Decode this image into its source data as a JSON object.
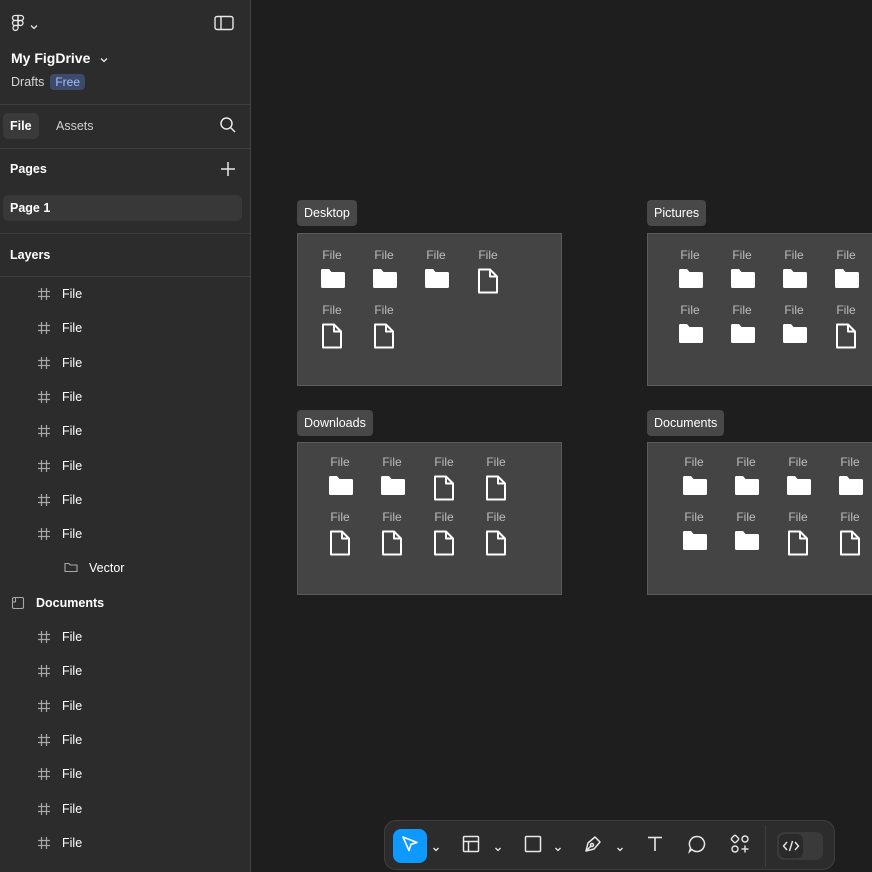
{
  "header": {
    "project_name": "My FigDrive",
    "location": "Drafts",
    "plan_badge": "Free"
  },
  "tabs": [
    {
      "label": "File",
      "active": true
    },
    {
      "label": "Assets",
      "active": false
    }
  ],
  "pages": {
    "title": "Pages",
    "items": [
      {
        "label": "Page 1",
        "selected": true
      }
    ]
  },
  "layers": {
    "title": "Layers",
    "items": [
      {
        "label": "File",
        "icon": "frame-icon"
      },
      {
        "label": "File",
        "icon": "frame-icon"
      },
      {
        "label": "File",
        "icon": "frame-icon"
      },
      {
        "label": "File",
        "icon": "frame-icon"
      },
      {
        "label": "File",
        "icon": "frame-icon"
      },
      {
        "label": "File",
        "icon": "frame-icon"
      },
      {
        "label": "File",
        "icon": "frame-icon"
      },
      {
        "label": "File",
        "icon": "frame-icon"
      },
      {
        "label": "Vector",
        "icon": "folder-icon"
      },
      {
        "label": "Documents",
        "icon": "section-icon"
      },
      {
        "label": "File",
        "icon": "frame-icon"
      },
      {
        "label": "File",
        "icon": "frame-icon"
      },
      {
        "label": "File",
        "icon": "frame-icon"
      },
      {
        "label": "File",
        "icon": "frame-icon"
      },
      {
        "label": "File",
        "icon": "frame-icon"
      },
      {
        "label": "File",
        "icon": "frame-icon"
      },
      {
        "label": "File",
        "icon": "frame-icon"
      }
    ]
  },
  "canvas": {
    "frames": [
      {
        "name": "Desktop",
        "items": [
          {
            "label": "File",
            "icon": "folder"
          },
          {
            "label": "File",
            "icon": "folder"
          },
          {
            "label": "File",
            "icon": "folder"
          },
          {
            "label": "File",
            "icon": "document"
          },
          {
            "label": "File",
            "icon": "document"
          },
          {
            "label": "File",
            "icon": "document"
          }
        ]
      },
      {
        "name": "Pictures",
        "items": [
          {
            "label": "File",
            "icon": "folder"
          },
          {
            "label": "File",
            "icon": "folder"
          },
          {
            "label": "File",
            "icon": "folder"
          },
          {
            "label": "File",
            "icon": "folder"
          },
          {
            "label": "File",
            "icon": "folder"
          },
          {
            "label": "File",
            "icon": "folder"
          },
          {
            "label": "File",
            "icon": "folder"
          },
          {
            "label": "File",
            "icon": "document"
          }
        ]
      },
      {
        "name": "Downloads",
        "items": [
          {
            "label": "File",
            "icon": "folder"
          },
          {
            "label": "File",
            "icon": "folder"
          },
          {
            "label": "File",
            "icon": "document"
          },
          {
            "label": "File",
            "icon": "document"
          },
          {
            "label": "File",
            "icon": "document"
          },
          {
            "label": "File",
            "icon": "document"
          },
          {
            "label": "File",
            "icon": "document"
          },
          {
            "label": "File",
            "icon": "document"
          }
        ]
      },
      {
        "name": "Documents",
        "items": [
          {
            "label": "File",
            "icon": "folder"
          },
          {
            "label": "File",
            "icon": "folder"
          },
          {
            "label": "File",
            "icon": "folder"
          },
          {
            "label": "File",
            "icon": "folder"
          },
          {
            "label": "File",
            "icon": "folder"
          },
          {
            "label": "File",
            "icon": "folder"
          },
          {
            "label": "File",
            "icon": "document"
          },
          {
            "label": "File",
            "icon": "document"
          }
        ]
      }
    ]
  },
  "toolbar": {
    "tools": [
      {
        "name": "move-tool",
        "icon": "cursor-icon",
        "active": true
      },
      {
        "name": "frame-tool",
        "icon": "frame-tool-icon",
        "active": false
      },
      {
        "name": "shape-tool",
        "icon": "rectangle-icon",
        "active": false
      },
      {
        "name": "pen-tool",
        "icon": "pen-icon",
        "active": false
      },
      {
        "name": "text-tool",
        "icon": "text-icon",
        "active": false
      },
      {
        "name": "comment-tool",
        "icon": "comment-icon",
        "active": false
      },
      {
        "name": "actions-tool",
        "icon": "actions-icon",
        "active": false
      }
    ],
    "dev_mode": {
      "icon": "code-icon",
      "enabled": false
    }
  },
  "colors": {
    "accent": "#0d99ff",
    "sidebar_bg": "#2c2c2c",
    "canvas_bg": "#1e1e1e",
    "frame_bg": "#444444",
    "badge_bg": "#3d4a6b",
    "badge_text": "#9fc0ff"
  }
}
